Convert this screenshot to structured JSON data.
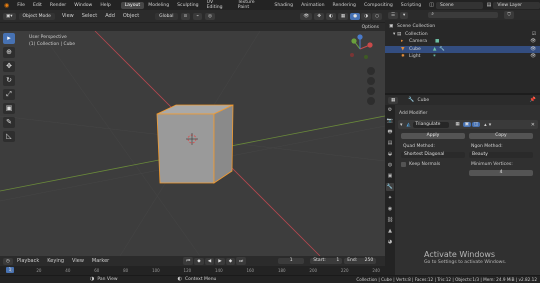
{
  "menu": {
    "items": [
      "File",
      "Edit",
      "Render",
      "Window",
      "Help"
    ]
  },
  "workspaces": [
    "Layout",
    "Modeling",
    "Sculpting",
    "UV Editing",
    "Texture Paint",
    "Shading",
    "Animation",
    "Rendering",
    "Compositing",
    "Scripting"
  ],
  "active_workspace": "Layout",
  "scene": {
    "label": "Scene"
  },
  "view_layer": {
    "label": "View Layer"
  },
  "viewport_header": {
    "mode": "Object Mode",
    "menus": [
      "View",
      "Select",
      "Add",
      "Object"
    ],
    "transform": "Global"
  },
  "options_label": "Options",
  "viewport": {
    "view_name": "User Perspective",
    "collection_path": "(1) Collection | Cube"
  },
  "outliner": {
    "rows": [
      {
        "label": "Scene Collection",
        "icon": "scene-collection-icon"
      },
      {
        "label": "Collection",
        "icon": "collection-icon"
      },
      {
        "label": "Camera",
        "icon": "camera-icon"
      },
      {
        "label": "Cube",
        "icon": "mesh-icon",
        "selected": true
      },
      {
        "label": "Light",
        "icon": "light-icon"
      }
    ]
  },
  "properties": {
    "object_name": "Cube",
    "add_modifier": "Add Modifier",
    "modifier_name": "Triangulate",
    "apply_label": "Apply",
    "copy_label": "Copy",
    "quad_method_label": "Quad Method:",
    "quad_method_value": "Shortest Diagonal",
    "ngon_method_label": "Ngon Method:",
    "ngon_method_value": "Beauty",
    "keep_normals_label": "Keep Normals",
    "min_vertices_label": "Minimum Vertices:",
    "min_vertices_value": "4"
  },
  "timeline": {
    "menus": [
      "Playback",
      "Keying",
      "View",
      "Marker"
    ],
    "current_frame": "1",
    "start_label": "Start:",
    "start_value": "1",
    "end_label": "End:",
    "end_value": "250",
    "ruler_ticks": [
      "0",
      "20",
      "40",
      "60",
      "80",
      "100",
      "120",
      "140",
      "160",
      "180",
      "200",
      "220",
      "240"
    ]
  },
  "status": {
    "left": "Pan View",
    "middle": "Context Menu",
    "stats": "Collection | Cube | Verts:8 | Faces:12 | Tris:12 | Objects:1/3 | Mem: 24.9 MiB | v2.82.12"
  },
  "watermark": {
    "title": "Activate Windows",
    "subtitle": "Go to Settings to activate Windows."
  },
  "colors": {
    "accent": "#4772b3",
    "selection_orange": "#f39a2d",
    "x_axis": "#b3474f",
    "y_axis": "#6a8a3a"
  }
}
